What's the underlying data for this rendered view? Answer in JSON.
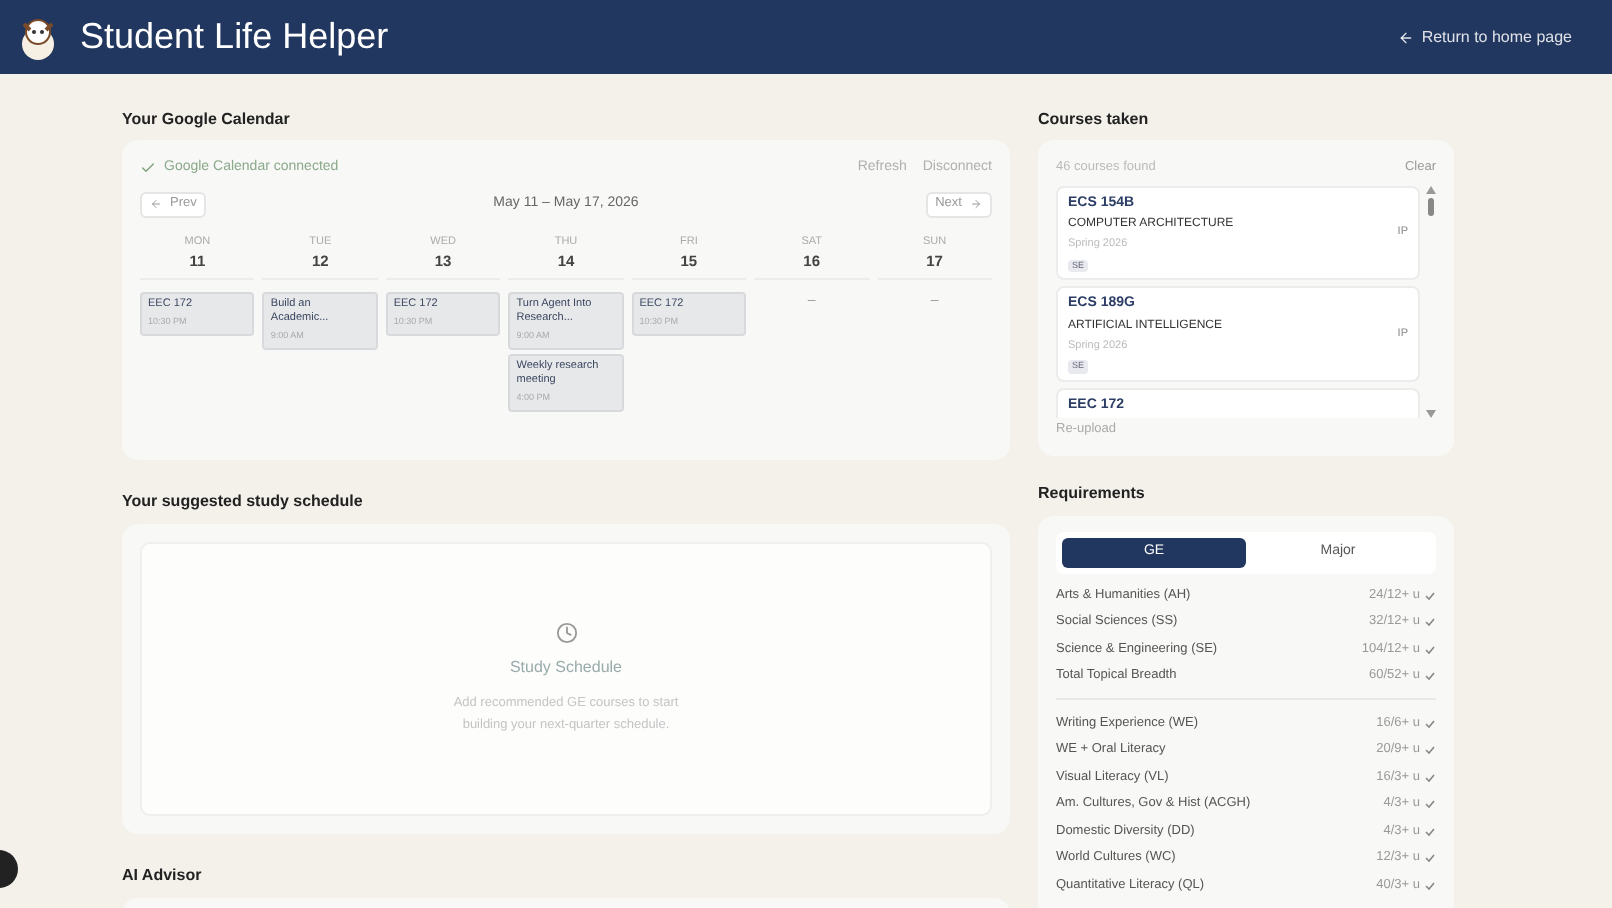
{
  "header": {
    "title": "Student Life Helper",
    "back_link": "Return to home page"
  },
  "calendar": {
    "heading": "Your Google Calendar",
    "status": "Google Calendar connected",
    "actions": [
      "Refresh",
      "Disconnect"
    ],
    "prev": "Prev",
    "next": "Next",
    "range": "May 11 – May 17, 2026",
    "days": [
      {
        "name": "MON",
        "date": "11",
        "events": [
          {
            "title": "EEC 172",
            "time": "10:30 PM"
          }
        ]
      },
      {
        "name": "TUE",
        "date": "12",
        "events": [
          {
            "title": "Build an Academic...",
            "time": "9:00 AM"
          }
        ]
      },
      {
        "name": "WED",
        "date": "13",
        "events": [
          {
            "title": "EEC 172",
            "time": "10:30 PM"
          }
        ]
      },
      {
        "name": "THU",
        "date": "14",
        "events": [
          {
            "title": "Turn Agent Into Research...",
            "time": "9:00 AM"
          },
          {
            "title": "Weekly research meeting",
            "time": "4:00 PM"
          }
        ]
      },
      {
        "name": "FRI",
        "date": "15",
        "events": [
          {
            "title": "EEC 172",
            "time": "10:30 PM"
          }
        ]
      },
      {
        "name": "SAT",
        "date": "16",
        "empty": "–"
      },
      {
        "name": "SUN",
        "date": "17",
        "empty": "–"
      }
    ]
  },
  "schedule": {
    "heading": "Your suggested study schedule",
    "title": "Study Schedule",
    "text": "Add recommended GE courses to start building your next-quarter schedule."
  },
  "advisor": {
    "heading": "AI Advisor"
  },
  "courses": {
    "heading": "Courses taken",
    "count": "46 courses found",
    "clear": "Clear",
    "reupload": "Re-upload",
    "items": [
      {
        "code": "ECS 154B",
        "name": "COMPUTER ARCHITECTURE",
        "term": "Spring 2026",
        "tag": "SE",
        "status": "IP"
      },
      {
        "code": "ECS 189G",
        "name": "ARTIFICIAL INTELLIGENCE",
        "term": "Spring 2026",
        "tag": "SE",
        "status": "IP"
      },
      {
        "code": "EEC 172"
      }
    ]
  },
  "requirements": {
    "heading": "Requirements",
    "tabs": [
      {
        "label": "GE",
        "selected": true
      },
      {
        "label": "Major",
        "selected": false
      }
    ],
    "groups": [
      [
        {
          "name": "Arts & Humanities (AH)",
          "value": "24/12+ u",
          "met": true
        },
        {
          "name": "Social Sciences (SS)",
          "value": "32/12+ u",
          "met": true
        },
        {
          "name": "Science & Engineering (SE)",
          "value": "104/12+ u",
          "met": true
        },
        {
          "name": "Total Topical Breadth",
          "value": "60/52+ u",
          "met": true
        }
      ],
      [
        {
          "name": "Writing Experience (WE)",
          "value": "16/6+ u",
          "met": true
        },
        {
          "name": "WE + Oral Literacy",
          "value": "20/9+ u",
          "met": true
        },
        {
          "name": "Visual Literacy (VL)",
          "value": "16/3+ u",
          "met": true
        },
        {
          "name": "Am. Cultures, Gov & Hist (ACGH)",
          "value": "4/3+ u",
          "met": true
        },
        {
          "name": "Domestic Diversity (DD)",
          "value": "4/3+ u",
          "met": true
        },
        {
          "name": "World Cultures (WC)",
          "value": "12/3+ u",
          "met": true
        },
        {
          "name": "Quantitative Literacy (QL)",
          "value": "40/3+ u",
          "met": true
        }
      ]
    ]
  }
}
